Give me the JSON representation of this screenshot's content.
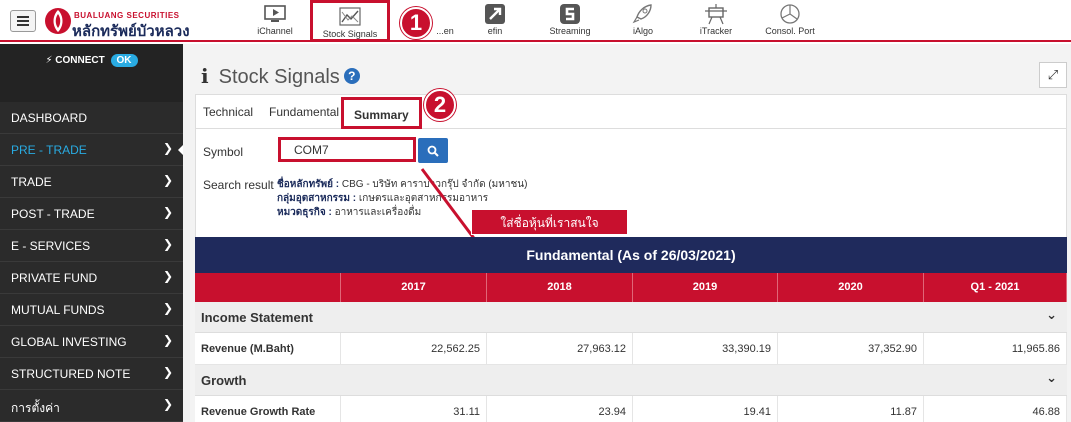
{
  "brand": {
    "name_en": "BUALUANG SECURITIES",
    "name_th": "หลักทรัพย์บัวหลวง"
  },
  "topnav": [
    {
      "label": "iChannel",
      "icon": "monitor-icon"
    },
    {
      "label": "Stock Signals",
      "icon": "chart-signal-icon"
    },
    {
      "label": "...en",
      "icon": "globe-icon"
    },
    {
      "label": "efin",
      "icon": "efin-icon"
    },
    {
      "label": "Streaming",
      "icon": "streaming-icon"
    },
    {
      "label": "iAlgo",
      "icon": "rocket-icon"
    },
    {
      "label": "iTracker",
      "icon": "tracker-icon"
    },
    {
      "label": "Consol. Port",
      "icon": "pie-icon"
    }
  ],
  "annotations": {
    "step1": "1",
    "step2": "2",
    "callout": "ใส่ชื่อหุ้นที่เราสนใจ"
  },
  "colors": {
    "brand_red": "#c8102e",
    "navy": "#1f2a5c",
    "accent_blue": "#29abe2"
  },
  "sidebar": {
    "connect_label": "CONNECT",
    "connect_status": "OK",
    "items": [
      {
        "label": "DASHBOARD"
      },
      {
        "label": "PRE - TRADE"
      },
      {
        "label": "TRADE"
      },
      {
        "label": "POST - TRADE"
      },
      {
        "label": "E - SERVICES"
      },
      {
        "label": "PRIVATE FUND"
      },
      {
        "label": "MUTUAL FUNDS"
      },
      {
        "label": "GLOBAL INVESTING"
      },
      {
        "label": "STRUCTURED NOTE"
      },
      {
        "label": "การตั้งค่า"
      }
    ]
  },
  "page": {
    "title": "Stock Signals",
    "tabs": [
      {
        "label": "Technical"
      },
      {
        "label": "Fundamental"
      },
      {
        "label": "Summary"
      }
    ],
    "symbol_label": "Symbol",
    "symbol_value": "COM7",
    "search_result_label": "Search result",
    "search_result": {
      "name_key": "ชื่อหลักทรัพย์ :",
      "name_val": "CBG - บริษัท คาราบาวกรุ๊ป จำกัด (มหาชน)",
      "industry_key": "กลุ่มอุตสาหกรรม :",
      "industry_val": "เกษตรและอุตสาหกรรมอาหาร",
      "sector_key": "หมวดธุรกิจ :",
      "sector_val": "อาหารและเครื่องดื่ม"
    }
  },
  "table": {
    "title": "Fundamental (As of 26/03/2021)",
    "columns": [
      "",
      "2017",
      "2018",
      "2019",
      "2020",
      "Q1 - 2021"
    ],
    "sections": [
      {
        "title": "Income Statement",
        "rows": [
          {
            "label": "Revenue (M.Baht)",
            "values": [
              "22,562.25",
              "27,963.12",
              "33,390.19",
              "37,352.90",
              "11,965.86"
            ]
          }
        ]
      },
      {
        "title": "Growth",
        "rows": [
          {
            "label": "Revenue Growth Rate (%)",
            "values": [
              "31.11",
              "23.94",
              "19.41",
              "11.87",
              "46.88"
            ]
          }
        ]
      }
    ]
  }
}
